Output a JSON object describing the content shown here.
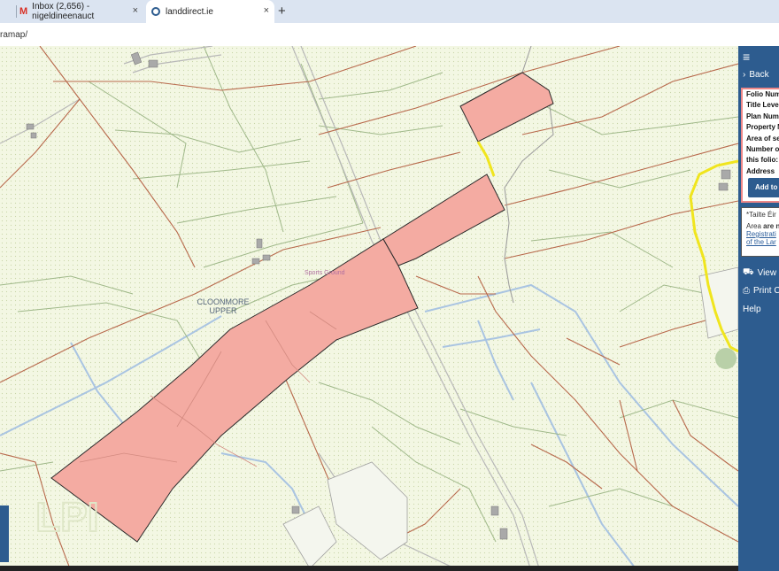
{
  "browser": {
    "tabs": [
      {
        "label": "Inbox (2,656) - nigeldineenauct",
        "icon": "gmail-icon"
      },
      {
        "label": "landdirect.ie",
        "icon": "landdirect-icon"
      }
    ],
    "new_tab_label": "+",
    "close_label": "×",
    "address": "ramap/"
  },
  "map": {
    "townland_label": "CLOONMORE\nUPPER",
    "townland_line1": "CLOONMORE",
    "townland_line2": "UPPER",
    "sports_label": "Sports Ground",
    "watermark": "LPI",
    "colors": {
      "background": "#f3f7e3",
      "parcel_fill": "#f4aba2",
      "road": "#bdbdbd",
      "boundary": "#b5694d",
      "highlight": "#f0e51e",
      "water": "#9fbfe0"
    }
  },
  "panel": {
    "menu_icon": "hamburger-icon",
    "back_label": "Back",
    "info_rows": [
      "Folio Num",
      "Title Level",
      "Plan Num",
      "Property N",
      "Area of se",
      "Number o",
      "this folio:",
      "Address"
    ],
    "add_button": "Add to",
    "notice_line1": "*Tailte Éir",
    "notice_line2_a": "Area ",
    "notice_line2_b": "are n",
    "notice_link1": "Registrati",
    "notice_link2": "of the Lar",
    "view_label": "View E",
    "print_label": "Print C",
    "help_label": "Help"
  }
}
